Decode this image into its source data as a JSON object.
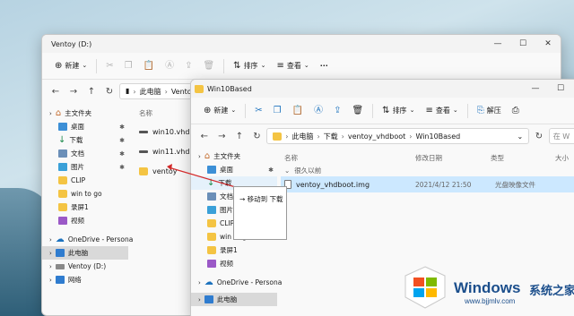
{
  "back_window": {
    "title": "Ventoy (D:)",
    "controls": [
      "—",
      "☐",
      "✕"
    ],
    "toolbar": {
      "new_label": "新建",
      "sort_label": "排序",
      "view_label": "查看",
      "more_label": "···"
    },
    "breadcrumb": [
      "此电脑",
      "Ventoy"
    ],
    "col_name": "名称",
    "sidebar": [
      {
        "label": "主文件夹",
        "icon": "home-icon"
      },
      {
        "label": "桌面",
        "icon": "desktop-icon"
      },
      {
        "label": "下载",
        "icon": "download-icon"
      },
      {
        "label": "文档",
        "icon": "document-icon"
      },
      {
        "label": "图片",
        "icon": "picture-icon"
      },
      {
        "label": "CLIP",
        "icon": "folder-icon"
      },
      {
        "label": "win to go",
        "icon": "folder-icon"
      },
      {
        "label": "录屏1",
        "icon": "folder-icon"
      },
      {
        "label": "视频",
        "icon": "video-icon"
      },
      {
        "label": "OneDrive - Persona",
        "icon": "cloud-icon"
      },
      {
        "label": "此电脑",
        "icon": "pc-icon"
      },
      {
        "label": "Ventoy (D:)",
        "icon": "drive-icon"
      },
      {
        "label": "网络",
        "icon": "network-icon"
      }
    ],
    "files": [
      "win10.vhdx",
      "win11.vhdx",
      "ventoy"
    ]
  },
  "front_window": {
    "title": "Win10Based",
    "controls": [
      "—",
      "☐"
    ],
    "toolbar": {
      "new_label": "新建",
      "sort_label": "排序",
      "view_label": "查看",
      "unzip_label": "解压"
    },
    "breadcrumb": [
      "此电脑",
      "下载",
      "ventoy_vhdboot",
      "Win10Based"
    ],
    "search_placeholder": "在 W",
    "columns": {
      "name": "名称",
      "modified": "修改日期",
      "type": "类型",
      "size": "大小"
    },
    "group_label": "很久以前",
    "sidebar": [
      {
        "label": "主文件夹",
        "icon": "home-icon"
      },
      {
        "label": "桌面",
        "icon": "desktop-icon"
      },
      {
        "label": "下载",
        "icon": "download-icon"
      },
      {
        "label": "文档",
        "icon": "document-icon"
      },
      {
        "label": "图片",
        "icon": "picture-icon"
      },
      {
        "label": "CLIP",
        "icon": "folder-icon"
      },
      {
        "label": "win to go",
        "icon": "folder-icon"
      },
      {
        "label": "录屏1",
        "icon": "folder-icon"
      },
      {
        "label": "视频",
        "icon": "video-icon"
      },
      {
        "label": "OneDrive - Persona",
        "icon": "cloud-icon"
      },
      {
        "label": "此电脑",
        "icon": "pc-icon"
      }
    ],
    "file": {
      "name": "ventoy_vhdboot.img",
      "modified": "2021/4/12 21:50",
      "type": "光盘映像文件"
    }
  },
  "drag_tooltip": {
    "label": "→ 移动到 下载"
  },
  "watermark": {
    "brand": "Windows",
    "brand_cn": "系统之家",
    "url": "www.bjjmlv.com"
  },
  "colors": {
    "folder": "#f4c443",
    "accent": "#1c4f8c",
    "selection": "#cce8ff",
    "drag_line": "#d32a2a"
  }
}
